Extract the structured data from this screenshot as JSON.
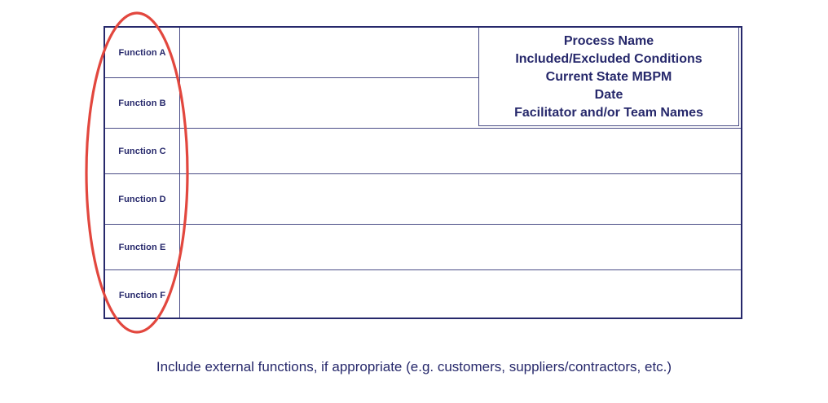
{
  "lanes": [
    {
      "label": "Function A"
    },
    {
      "label": "Function B"
    },
    {
      "label": "Function C"
    },
    {
      "label": "Function D"
    },
    {
      "label": "Function E"
    },
    {
      "label": "Function F"
    }
  ],
  "title_block": {
    "process_name": "Process Name",
    "conditions": "Included/Excluded Conditions",
    "state": "Current State MBPM",
    "date": "Date",
    "facilitator": "Facilitator and/or Team Names"
  },
  "footer_note": "Include external functions, if appropriate (e.g. customers, suppliers/contractors, etc.)",
  "colors": {
    "text": "#26286b",
    "border": "#26286b",
    "highlight": "#e2473e"
  }
}
